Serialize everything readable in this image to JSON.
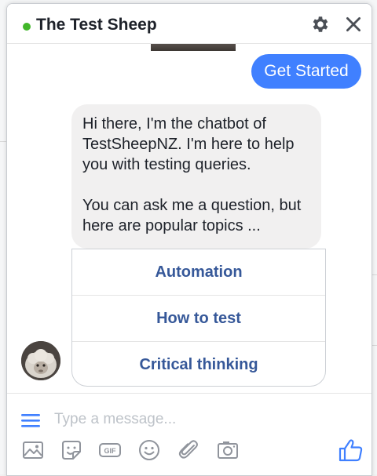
{
  "header": {
    "title": "The Test Sheep",
    "status_color": "#42b72a",
    "settings_icon": "gear-icon",
    "close_icon": "close-icon"
  },
  "conversation": {
    "user_message": "Get Started",
    "bot_message": {
      "paragraph_1": "Hi there, I'm the chatbot of TestSheepNZ.  I'm here to help you with testing queries.",
      "paragraph_2": "You can ask me a question, but here are popular topics ..."
    },
    "quick_replies": [
      {
        "label": "Automation"
      },
      {
        "label": "How to test"
      },
      {
        "label": "Critical thinking"
      }
    ],
    "bot_avatar_icon": "sheep-avatar"
  },
  "composer": {
    "placeholder": "Type a message...",
    "value": "",
    "tools": [
      "photo-icon",
      "sticker-icon",
      "gif-icon",
      "emoji-icon",
      "attachment-icon",
      "camera-icon"
    ],
    "gif_label": "GIF",
    "send_icon": "thumbs-up-icon"
  },
  "colors": {
    "accent": "#4080ff",
    "link": "#365899",
    "bubble_grey": "#f1f0f0",
    "icon_grey": "#90949c"
  }
}
